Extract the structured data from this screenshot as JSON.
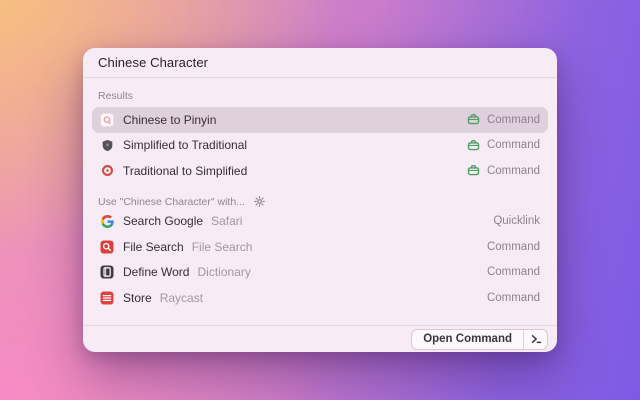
{
  "search": {
    "value": "Chinese Character"
  },
  "results": {
    "label": "Results",
    "items": [
      {
        "title": "Chinese to Pinyin",
        "type": "Command",
        "icon": "pinyin-icon",
        "selected": true,
        "type_icon": "command-briefcase-icon"
      },
      {
        "title": "Simplified to Traditional",
        "type": "Command",
        "icon": "shield-icon",
        "selected": false,
        "type_icon": "command-briefcase-icon"
      },
      {
        "title": "Traditional to Simplified",
        "type": "Command",
        "icon": "target-icon",
        "selected": false,
        "type_icon": "command-briefcase-icon"
      }
    ]
  },
  "use_with": {
    "label": "Use \"Chinese Character\" with...",
    "settings_icon": "gear-icon",
    "items": [
      {
        "title": "Search Google",
        "subtitle": "Safari",
        "type": "Quicklink",
        "icon": "google-icon"
      },
      {
        "title": "File Search",
        "subtitle": "File Search",
        "type": "Command",
        "icon": "file-search-icon"
      },
      {
        "title": "Define Word",
        "subtitle": "Dictionary",
        "type": "Command",
        "icon": "dictionary-icon"
      },
      {
        "title": "Store",
        "subtitle": "Raycast",
        "type": "Command",
        "icon": "store-icon"
      }
    ]
  },
  "footer": {
    "primary_action": "Open Command",
    "key_icon": "terminal-prompt-icon"
  },
  "colors": {
    "command_green": "#4f9e63",
    "icon_red": "#e0433f",
    "selected_row_bg": "#ded0dc",
    "window_bg": "#f7ecf5"
  }
}
